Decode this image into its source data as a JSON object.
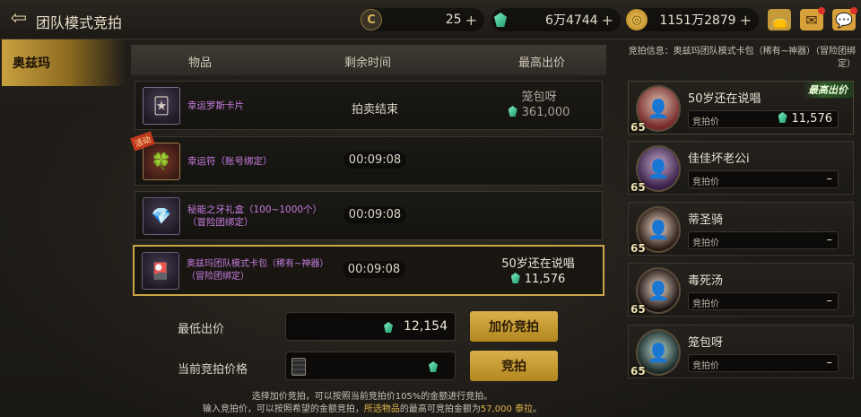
{
  "header": {
    "back_icon": "back-arrow-icon",
    "title": "团队模式竞拍",
    "currencies": [
      {
        "icon": "coin-c-icon",
        "value": "25",
        "color": "#c9a84a"
      },
      {
        "icon": "green-gem-icon",
        "value": "6万4744",
        "color": "#36c48a"
      },
      {
        "icon": "gold-coin-icon",
        "value": "1151万2879",
        "color": "#d7a63a"
      }
    ],
    "plus": "+",
    "icons": [
      "bag-icon",
      "mail-icon",
      "chat-icon"
    ]
  },
  "left_tab": {
    "label": "奥兹玛"
  },
  "table": {
    "headers": {
      "item": "物品",
      "time": "剩余时间",
      "bid": "最高出价"
    },
    "rows": [
      {
        "name": "幸运罗斯卡片",
        "time": "拍卖结束",
        "bidder": "笼包呀",
        "price": "361,000",
        "icon": "card-icon",
        "promo": ""
      },
      {
        "name": "幸运符（账号绑定）",
        "time": "00:09:08",
        "bidder": "",
        "price": "",
        "icon": "charm-icon",
        "promo": "活动"
      },
      {
        "name": "秘能之牙礼盒（100~1000个）\n（冒险团绑定）",
        "time": "00:09:08",
        "bidder": "",
        "price": "",
        "icon": "fang-box-icon",
        "promo": ""
      },
      {
        "name": "奥兹玛团队模式卡包（稀有~神器）\n（冒险团绑定）",
        "time": "00:09:08",
        "bidder": "50岁还在说唱",
        "price": "11,576",
        "icon": "card-pack-icon",
        "promo": ""
      }
    ]
  },
  "form": {
    "min_bid_label": "最低出价",
    "min_bid_value": "12,154",
    "raise_button": "加价竞拍",
    "current_bid_label": "当前竞拍价格",
    "current_bid_value": "",
    "bid_button": "竞拍"
  },
  "footer": {
    "line1": "选择加价竞拍，可以按照当前竞拍价105%的金额进行竞拍。",
    "line2_pre": "输入竞拍价，可以按照希望的金额竞拍，",
    "line2_hl1": "所选物品",
    "line2_mid": "的最高可竞拍金额为",
    "line2_hl2": "57,000 泰拉",
    "line2_end": "。"
  },
  "bid_info": {
    "text": "竞拍信息：奥兹玛团队模式卡包（稀有~神器）（冒险团绑定）"
  },
  "bidders": [
    {
      "name": "50岁还在说唱",
      "level": "65",
      "price_label": "竞拍价",
      "price": "11,576",
      "best": "最高出价",
      "avatar": "avatar-icon"
    },
    {
      "name": "佳佳坏老公i",
      "level": "65",
      "price_label": "竞拍价",
      "price": "–",
      "best": "",
      "avatar": "avatar-icon"
    },
    {
      "name": "蒂圣骑",
      "level": "65",
      "price_label": "竞拍价",
      "price": "–",
      "best": "",
      "avatar": "avatar-icon"
    },
    {
      "name": "毒死汤",
      "level": "65",
      "price_label": "竞拍价",
      "price": "–",
      "best": "",
      "avatar": "avatar-icon"
    },
    {
      "name": "笼包呀",
      "level": "65",
      "price_label": "竞拍价",
      "price": "–",
      "best": "",
      "avatar": "avatar-icon"
    }
  ]
}
